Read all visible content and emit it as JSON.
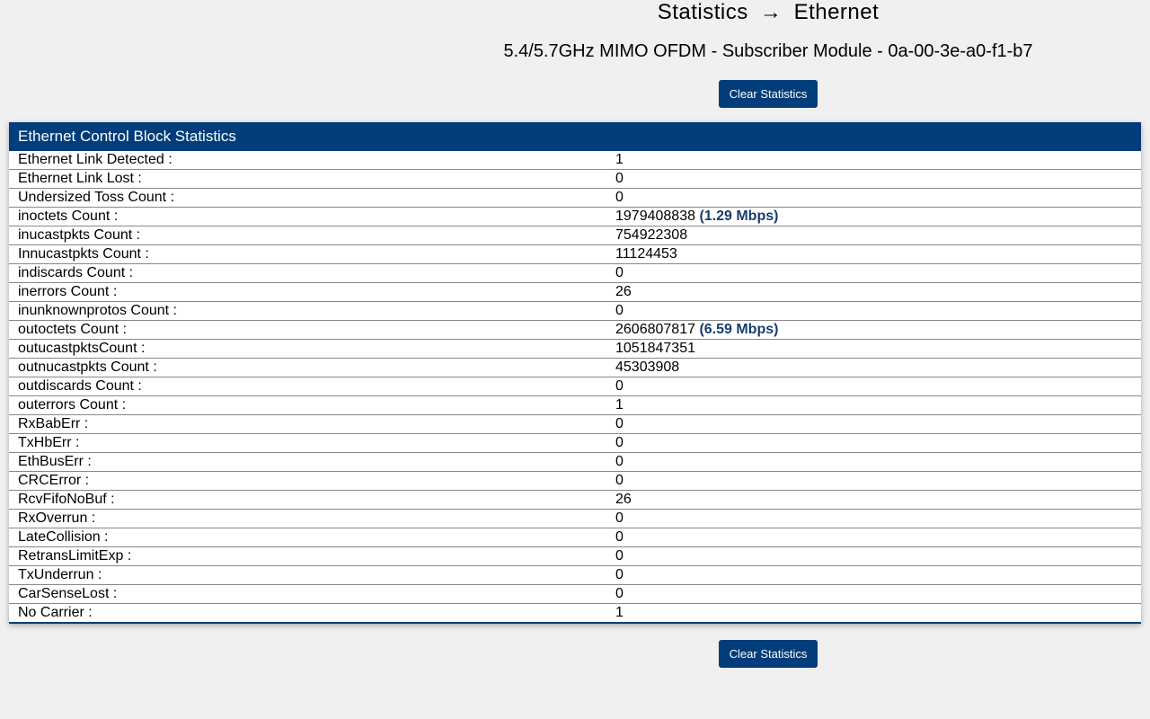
{
  "header": {
    "breadcrumb_left": "Statistics",
    "breadcrumb_right": "Ethernet",
    "subtitle": "5.4/5.7GHz MIMO OFDM - Subscriber Module - 0a-00-3e-a0-f1-b7",
    "clear_button": "Clear Statistics"
  },
  "panel": {
    "title": "Ethernet Control Block Statistics"
  },
  "stats": [
    {
      "label": "Ethernet Link Detected :",
      "value": "1",
      "rate": ""
    },
    {
      "label": "Ethernet Link Lost :",
      "value": "0",
      "rate": ""
    },
    {
      "label": "Undersized Toss Count :",
      "value": "0",
      "rate": ""
    },
    {
      "label": "inoctets Count :",
      "value": "1979408838 ",
      "rate": "(1.29 Mbps)"
    },
    {
      "label": "inucastpkts Count :",
      "value": "754922308",
      "rate": ""
    },
    {
      "label": "Innucastpkts Count :",
      "value": "11124453",
      "rate": ""
    },
    {
      "label": "indiscards Count :",
      "value": "0",
      "rate": ""
    },
    {
      "label": "inerrors Count :",
      "value": "26",
      "rate": ""
    },
    {
      "label": "inunknownprotos Count :",
      "value": "0",
      "rate": ""
    },
    {
      "label": "outoctets Count :",
      "value": "2606807817 ",
      "rate": "(6.59 Mbps)"
    },
    {
      "label": "outucastpktsCount :",
      "value": "1051847351",
      "rate": ""
    },
    {
      "label": "outnucastpkts Count :",
      "value": "45303908",
      "rate": ""
    },
    {
      "label": "outdiscards Count :",
      "value": "0",
      "rate": ""
    },
    {
      "label": "outerrors Count :",
      "value": "1",
      "rate": ""
    },
    {
      "label": "RxBabErr :",
      "value": "0",
      "rate": ""
    },
    {
      "label": "TxHbErr :",
      "value": "0",
      "rate": ""
    },
    {
      "label": "EthBusErr :",
      "value": "0",
      "rate": ""
    },
    {
      "label": "CRCError :",
      "value": "0",
      "rate": ""
    },
    {
      "label": "RcvFifoNoBuf :",
      "value": "26",
      "rate": ""
    },
    {
      "label": "RxOverrun :",
      "value": "0",
      "rate": ""
    },
    {
      "label": "LateCollision :",
      "value": "0",
      "rate": ""
    },
    {
      "label": "RetransLimitExp :",
      "value": "0",
      "rate": ""
    },
    {
      "label": "TxUnderrun :",
      "value": "0",
      "rate": ""
    },
    {
      "label": "CarSenseLost :",
      "value": "0",
      "rate": ""
    },
    {
      "label": "No Carrier :",
      "value": "1",
      "rate": ""
    }
  ],
  "footer": {
    "clear_button": "Clear Statistics"
  }
}
